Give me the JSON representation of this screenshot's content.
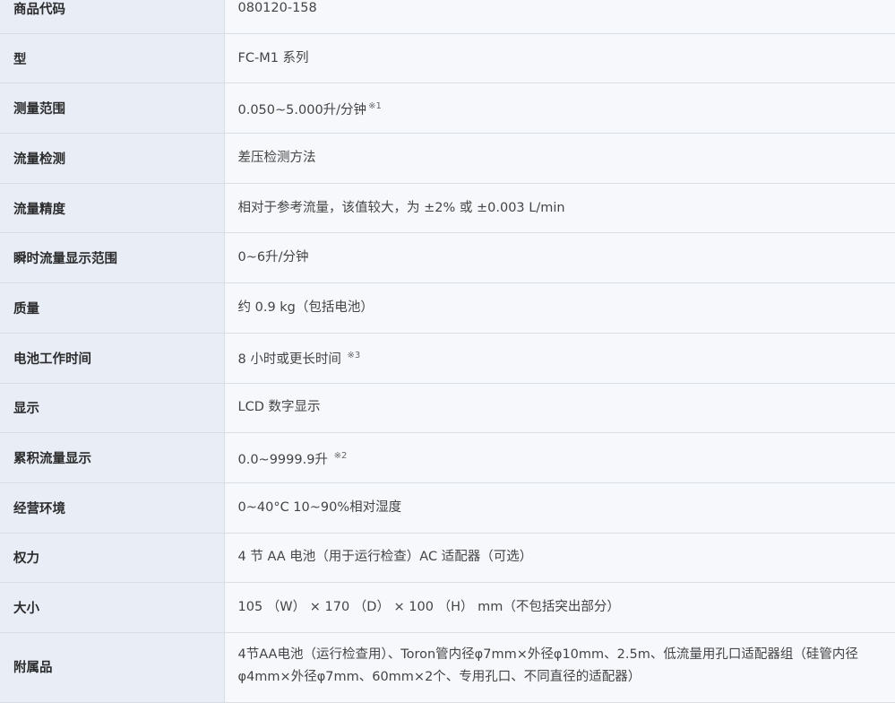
{
  "rows": [
    {
      "label": "商品代码",
      "value": "080120-158",
      "note": ""
    },
    {
      "label": "型",
      "value": "FC-M1 系列",
      "note": ""
    },
    {
      "label": "测量范围",
      "value": "0.050~5.000升/分钟",
      "note": "※1"
    },
    {
      "label": "流量检测",
      "value": "差压检测方法",
      "note": ""
    },
    {
      "label": "流量精度",
      "value": "相对于参考流量，该值较大，为 ±2% 或 ±0.003 L/min",
      "note": ""
    },
    {
      "label": "瞬时流量显示范围",
      "value": "0~6升/分钟",
      "note": ""
    },
    {
      "label": "质量",
      "value": "约 0.9 kg（包括电池）",
      "note": ""
    },
    {
      "label": "电池工作时间",
      "value": "8 小时或更长时间",
      "note": "※3"
    },
    {
      "label": "显示",
      "value": "LCD 数字显示",
      "note": ""
    },
    {
      "label": "累积流量显示",
      "value": "0.0~9999.9升",
      "note": "※2"
    },
    {
      "label": "经营环境",
      "value": "0~40°C 10~90%相对湿度",
      "note": ""
    },
    {
      "label": "权力",
      "value": "4 节 AA 电池（用于运行检查）AC 适配器（可选）",
      "note": ""
    },
    {
      "label": "大小",
      "value": "105 （W） × 170 （D） × 100 （H） mm（不包括突出部分）",
      "note": ""
    },
    {
      "label": "附属品",
      "value": "4节AA电池（运行检查用）、Toron管内径φ7mm×外径φ10mm、2.5m、低流量用孔口适配器组（硅管内径φ4mm×外径φ7mm、60mm×2个、专用孔口、不同直径的适配器）",
      "note": ""
    }
  ]
}
